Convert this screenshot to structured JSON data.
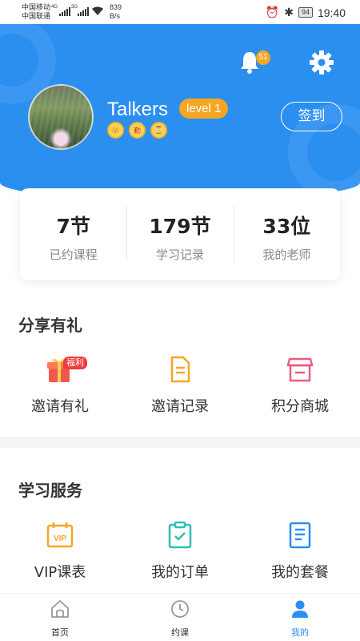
{
  "status_bar": {
    "carrier_1": "中国移动",
    "carrier_2": "中国联通",
    "net_1": "4G",
    "net_2": "3G",
    "speed_value": "839",
    "speed_unit": "B/s",
    "battery": "94",
    "time": "19:40"
  },
  "header": {
    "notification_count": "51",
    "username": "Talkers",
    "level": "level 1",
    "signin_label": "签到",
    "medals": [
      "👑",
      "勤",
      "⏳"
    ]
  },
  "stats": [
    {
      "value": "7节",
      "label": "已约课程"
    },
    {
      "value": "179节",
      "label": "学习记录"
    },
    {
      "value": "33位",
      "label": "我的老师"
    }
  ],
  "share_section": {
    "title": "分享有礼",
    "gift_badge": "福利",
    "items": [
      {
        "label": "邀请有礼",
        "icon": "gift-icon"
      },
      {
        "label": "邀请记录",
        "icon": "document-icon"
      },
      {
        "label": "积分商城",
        "icon": "shop-icon"
      }
    ]
  },
  "study_section": {
    "title": "学习服务",
    "items": [
      {
        "label": "VIP课表",
        "icon": "vip-icon"
      },
      {
        "label": "我的订单",
        "icon": "order-icon"
      },
      {
        "label": "我的套餐",
        "icon": "package-icon"
      }
    ]
  },
  "bottom_nav": [
    {
      "label": "首页",
      "icon": "home-icon"
    },
    {
      "label": "约课",
      "icon": "clock-icon"
    },
    {
      "label": "我的",
      "icon": "person-icon",
      "active": true
    }
  ],
  "colors": {
    "primary": "#2b8ff0",
    "accent": "#f6a623",
    "pink": "#ee5a7e",
    "teal": "#2ebfb3"
  }
}
